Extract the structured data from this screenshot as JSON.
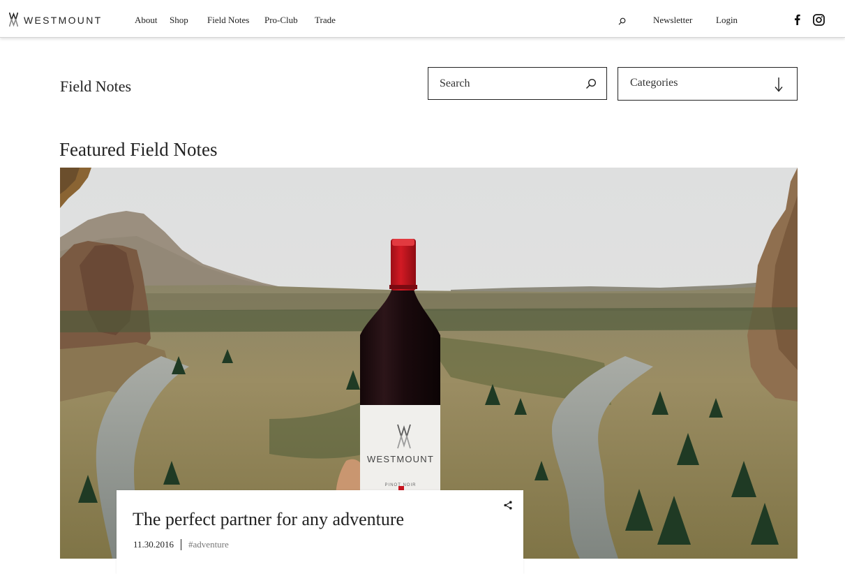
{
  "brand": {
    "name": "WESTMOUNT"
  },
  "nav": {
    "items": [
      "About",
      "Shop",
      "Field Notes",
      "Pro-Club",
      "Trade"
    ]
  },
  "header_right": {
    "newsletter": "Newsletter",
    "login": "Login"
  },
  "icons": {
    "search": "search-icon",
    "facebook": "facebook-icon",
    "instagram": "instagram-icon",
    "arrow": "arrow-down-icon",
    "share": "share-icon"
  },
  "page": {
    "title": "Field Notes"
  },
  "search": {
    "placeholder": "Search"
  },
  "categories": {
    "label": "Categories"
  },
  "featured": {
    "heading": "Featured Field Notes",
    "bottle_brand": "WESTMOUNT",
    "bottle_varietal": "PINOT NOIR",
    "post": {
      "title": "The perfect partner for any adventure",
      "date": "11.30.2016",
      "tag": "#adventure"
    }
  },
  "colors": {
    "text": "#222222",
    "bottle_cap": "#c8141f",
    "bottle_glass": "#1e0f12",
    "border": "#222222"
  }
}
